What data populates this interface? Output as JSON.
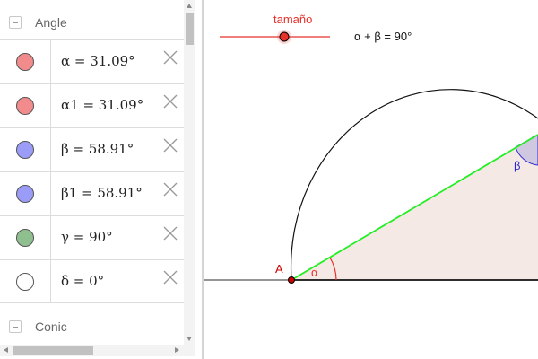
{
  "algebra": {
    "groups": [
      {
        "label": "Angle"
      },
      {
        "label": "Conic"
      }
    ],
    "items": [
      {
        "formula": "α = 31.09°",
        "color": "#f28b8b"
      },
      {
        "formula": "α1 = 31.09°",
        "color": "#f28b8b"
      },
      {
        "formula": "β = 58.91°",
        "color": "#9a9cf7"
      },
      {
        "formula": "β1 = 58.91°",
        "color": "#9a9cf7"
      },
      {
        "formula": "γ = 90°",
        "color": "#8fbf8f"
      },
      {
        "formula": "δ = 0°",
        "color": "#ffffff"
      }
    ]
  },
  "graphics": {
    "slider_label": "tamaño",
    "equation_text": "α + β = 90°",
    "point_label": "A",
    "angle_alpha_label": "α",
    "angle_beta_label": "β",
    "colors": {
      "slider": "#e8302a",
      "point": "#cc0000",
      "hypotenuse": "#22ee22",
      "triangle_fill": "#f4e9e4",
      "angle_alpha": "#e8302a",
      "angle_beta": "#2a2ad0",
      "arc": "#111111",
      "baseline": "#555555"
    }
  }
}
